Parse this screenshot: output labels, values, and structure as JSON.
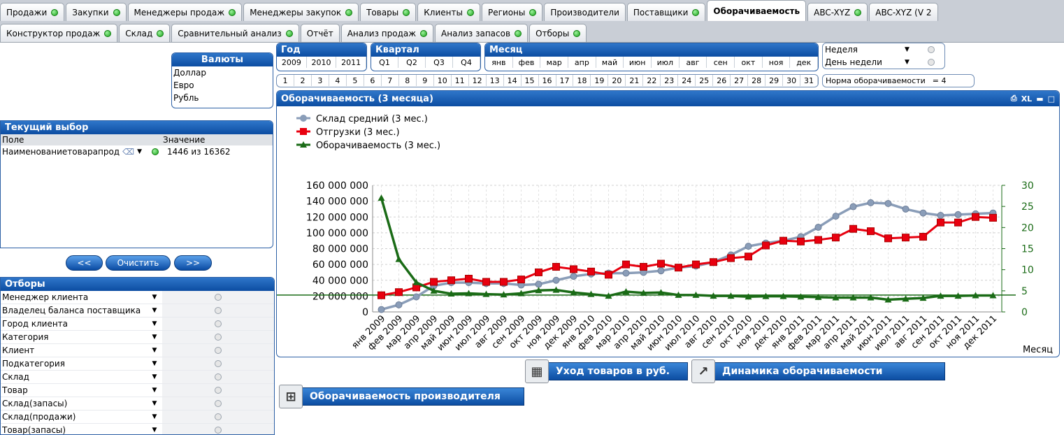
{
  "tabs_row1": [
    {
      "label": "Продажи",
      "dot": true
    },
    {
      "label": "Закупки",
      "dot": true
    },
    {
      "label": "Менеджеры продаж",
      "dot": true
    },
    {
      "label": "Менеджеры закупок",
      "dot": true
    },
    {
      "label": "Товары",
      "dot": true
    },
    {
      "label": "Клиенты",
      "dot": true
    },
    {
      "label": "Регионы",
      "dot": true
    },
    {
      "label": "Производители",
      "dot": false
    },
    {
      "label": "Поставщики",
      "dot": true
    },
    {
      "label": "Оборачиваемость",
      "dot": false,
      "active": true
    },
    {
      "label": "ABC-XYZ",
      "dot": true
    },
    {
      "label": "ABC-XYZ (V 2",
      "dot": false
    }
  ],
  "tabs_row2": [
    {
      "label": "Конструктор продаж",
      "dot": true
    },
    {
      "label": "Склад",
      "dot": true
    },
    {
      "label": "Сравнительный анализ",
      "dot": true
    },
    {
      "label": "Отчёт",
      "dot": false
    },
    {
      "label": "Анализ продаж",
      "dot": true
    },
    {
      "label": "Анализ запасов",
      "dot": true
    },
    {
      "label": "Отборы",
      "dot": true
    }
  ],
  "currencies": {
    "title": "Валюты",
    "items": [
      "Доллар",
      "Евро",
      "Рубль"
    ]
  },
  "year": {
    "title": "Год",
    "items": [
      "2009",
      "2010",
      "2011"
    ]
  },
  "quarter": {
    "title": "Квартал",
    "items": [
      "Q1",
      "Q2",
      "Q3",
      "Q4"
    ]
  },
  "month": {
    "title": "Месяц",
    "items": [
      "янв",
      "фев",
      "мар",
      "апр",
      "май",
      "июн",
      "июл",
      "авг",
      "сен",
      "окт",
      "ноя",
      "дек"
    ]
  },
  "days": [
    "1",
    "2",
    "3",
    "4",
    "5",
    "6",
    "7",
    "8",
    "9",
    "10",
    "11",
    "12",
    "13",
    "14",
    "15",
    "16",
    "17",
    "18",
    "19",
    "20",
    "21",
    "22",
    "23",
    "24",
    "25",
    "26",
    "27",
    "28",
    "29",
    "30",
    "31"
  ],
  "week_selectors": [
    {
      "label": "Неделя"
    },
    {
      "label": "День недели"
    }
  ],
  "norm": {
    "label": "Норма оборачиваемости",
    "value": "= 4"
  },
  "current_selection": {
    "title": "Текущий выбор",
    "col_field": "Поле",
    "col_value": "Значение",
    "rows": [
      {
        "field": "Наименованиетоварапрод",
        "value": "1446 из 16362"
      }
    ]
  },
  "nav_buttons": {
    "prev": "<<",
    "clear": "Очистить",
    "next": ">>"
  },
  "filters": {
    "title": "Отборы",
    "items": [
      "Менеджер клиента",
      "Владелец баланса поставщика",
      "Город клиента",
      "Категория",
      "Клиент",
      "Подкатегория",
      "Склад",
      "Товар",
      "Склад(запасы)",
      "Склад(продажи)",
      "Товар(запасы)"
    ]
  },
  "chart_panel": {
    "title": "Оборачиваемость (3 месяца)",
    "xl_label": "XL"
  },
  "buttons": {
    "outflow": "Уход товаров в руб.",
    "dynamics": "Динамика оборачиваемости",
    "manufacturer": "Оборачиваемость производителя"
  },
  "colors": {
    "stock": "#8a9db8",
    "ship": "#e8000f",
    "turn": "#1a6b16",
    "accent": "#0c4da2"
  },
  "chart_data": {
    "type": "line",
    "xlabel": "Месяц",
    "categories": [
      "янв 2009",
      "фев 2009",
      "мар 2009",
      "апр 2009",
      "май 2009",
      "июн 2009",
      "июл 2009",
      "авг 2009",
      "сен 2009",
      "окт 2009",
      "ноя 2009",
      "дек 2009",
      "янв 2010",
      "фев 2010",
      "мар 2010",
      "апр 2010",
      "май 2010",
      "июн 2010",
      "июл 2010",
      "авг 2010",
      "сен 2010",
      "окт 2010",
      "ноя 2010",
      "дек 2010",
      "янв 2011",
      "фев 2011",
      "мар 2011",
      "апр 2011",
      "май 2011",
      "июн 2011",
      "июл 2011",
      "авг 2011",
      "сен 2011",
      "окт 2011",
      "ноя 2011",
      "дек 2011"
    ],
    "y_left": {
      "min": 0,
      "max": 160000000,
      "ticks": [
        "0",
        "20 000 000",
        "40 000 000",
        "60 000 000",
        "80 000 000",
        "100 000 000",
        "120 000 000",
        "140 000 000",
        "160 000 000"
      ]
    },
    "y_right": {
      "min": 0,
      "max": 30,
      "ticks": [
        "0",
        "5",
        "10",
        "15",
        "20",
        "25",
        "30"
      ]
    },
    "reference_line_right": 4,
    "series": [
      {
        "name": "Склад средний (3 мес.)",
        "axis": "left",
        "values": [
          3000000,
          9000000,
          19000000,
          33000000,
          37000000,
          37000000,
          36000000,
          36000000,
          34000000,
          35000000,
          40000000,
          45000000,
          48000000,
          49000000,
          49000000,
          50000000,
          52000000,
          56000000,
          58000000,
          63000000,
          72000000,
          83000000,
          87000000,
          90000000,
          95000000,
          107000000,
          121000000,
          133000000,
          138000000,
          137000000,
          130000000,
          125000000,
          122000000,
          123000000,
          124000000,
          125000000
        ]
      },
      {
        "name": "Отгрузки (3 мес.)",
        "axis": "left",
        "values": [
          21000000,
          25000000,
          31000000,
          38000000,
          40000000,
          42000000,
          38000000,
          38000000,
          41000000,
          50000000,
          57000000,
          54000000,
          51000000,
          47000000,
          60000000,
          57000000,
          61000000,
          56000000,
          60000000,
          63000000,
          68000000,
          70000000,
          84000000,
          90000000,
          89000000,
          91000000,
          94000000,
          105000000,
          102000000,
          93000000,
          94000000,
          95000000,
          113000000,
          113000000,
          120000000,
          119000000
        ]
      },
      {
        "name": "Оборачиваемость (3 мес.)",
        "axis": "right",
        "values": [
          27,
          12.5,
          7,
          5,
          4.3,
          4.4,
          4.2,
          4.1,
          4.4,
          5.1,
          5.2,
          4.6,
          4.2,
          3.8,
          4.8,
          4.5,
          4.6,
          4.0,
          4.0,
          3.8,
          3.8,
          3.6,
          3.7,
          3.7,
          3.6,
          3.5,
          3.4,
          3.4,
          3.4,
          2.9,
          3.1,
          3.3,
          3.8,
          3.8,
          3.9,
          3.9
        ]
      }
    ]
  }
}
